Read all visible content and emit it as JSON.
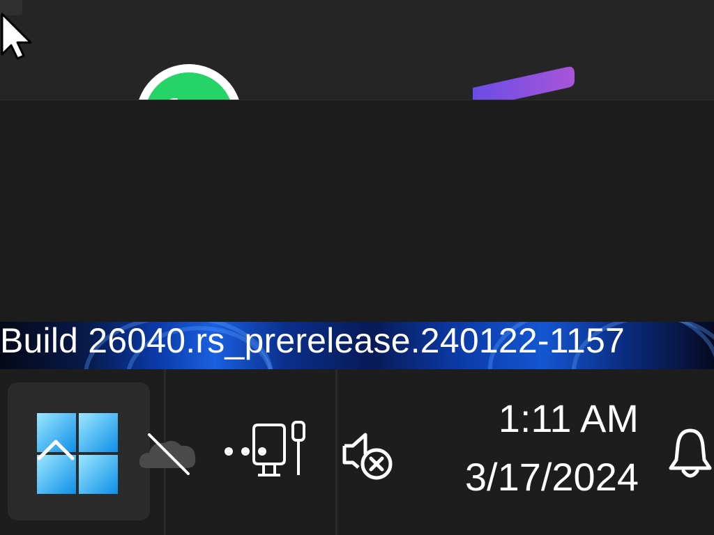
{
  "desktop": {
    "build_watermark": "Build 26040.rs_prerelease.240122-1157"
  },
  "windows": {
    "top_window_icons": [
      "whatsapp-logo",
      "purple-app-logo"
    ]
  },
  "taskbar": {
    "start_button_icon": "windows-logo-icon",
    "tray_overflow_icon": "chevron-up-icon",
    "tray_icons": [
      "onedrive-offline-icon",
      "network-disconnected-icon",
      "volume-muted-icon"
    ],
    "clock": {
      "time": "1:11 AM",
      "date": "3/17/2024"
    },
    "notification_icon": "bell-icon"
  },
  "colors": {
    "taskbar_bg": "#1d1d1d",
    "start_button_bg": "#2b2b2b",
    "window_bg": "#252526",
    "windows_logo_top": "#9be7ff",
    "windows_logo_bottom": "#0f8fe8",
    "whatsapp_green": "#25d366",
    "purple_accent": "#7b4ee8"
  }
}
